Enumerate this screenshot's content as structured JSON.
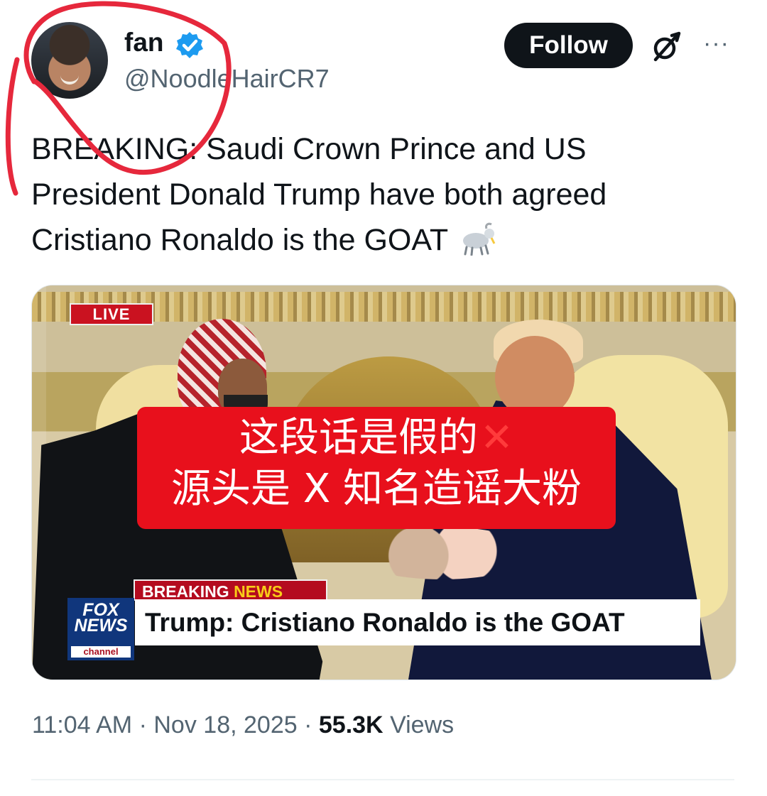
{
  "post": {
    "author": {
      "display_name": "fan",
      "handle": "@NoodleHairCR7",
      "verified_icon": "verified-badge-icon",
      "avatar_icon": "profile-avatar"
    },
    "actions": {
      "follow_label": "Follow",
      "grok_icon": "grok-icon",
      "more_icon": "more-options-icon"
    },
    "text_lines": [
      "BREAKING: Saudi Crown Prince and US",
      "President Donald Trump have both agreed",
      "Cristiano Ronaldo is the GOAT"
    ],
    "emoji": "goat-icon",
    "metadata": {
      "time": "11:04 AM",
      "separator": "·",
      "date": "Nov 18, 2025",
      "views_count": "55.3K",
      "views_label": "Views"
    }
  },
  "media": {
    "live_label": "LIVE",
    "warning_lines": [
      "这段话是假的",
      "源头是 X 知名造谣大粉"
    ],
    "warning_icon": "red-cross-icon",
    "breaking_label": "BREAKING",
    "breaking_news_label": "NEWS",
    "chyron_text": "Trump: Cristiano Ronaldo is the GOAT",
    "network_logo_top": "FOX",
    "network_logo_bottom": "NEWS",
    "network_logo_channel": "channel"
  },
  "colors": {
    "primary_text": "#0f1419",
    "secondary_text": "#536471",
    "annotation_red": "#e6283c",
    "warning_red": "#e8101c",
    "verified_blue": "#1d9bf0"
  }
}
